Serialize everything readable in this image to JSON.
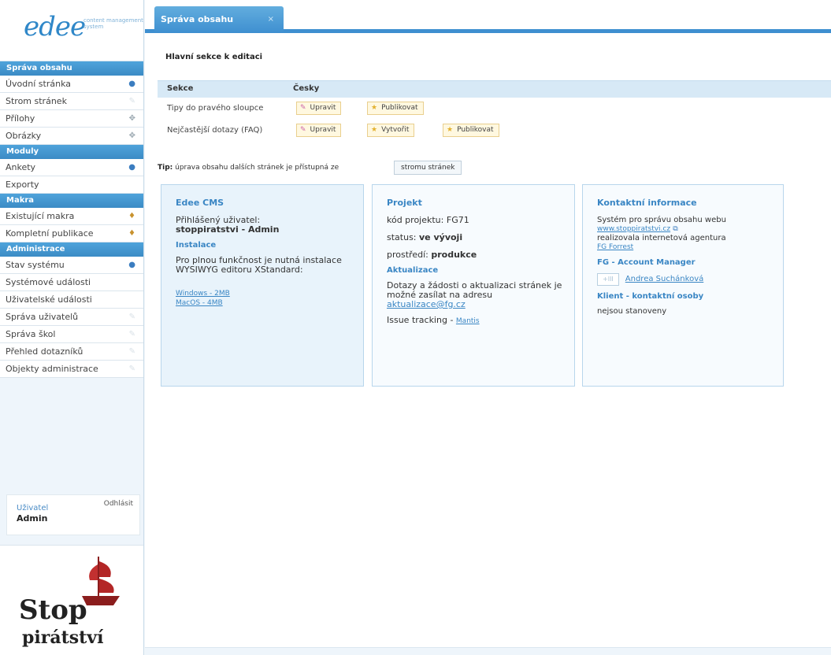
{
  "app": {
    "logo_text": "edee",
    "logo_sub": "content management system"
  },
  "sidebar": {
    "sections": [
      {
        "title": "Správa obsahu",
        "items": [
          {
            "label": "Úvodní stránka",
            "icon": "globe-icon"
          },
          {
            "label": "Strom stránek",
            "icon": "pencil-icon"
          },
          {
            "label": "Přílohy",
            "icon": "attachment-icon"
          },
          {
            "label": "Obrázky",
            "icon": "image-icon"
          }
        ]
      },
      {
        "title": "Moduly",
        "items": [
          {
            "label": "Ankety",
            "icon": "poll-icon"
          },
          {
            "label": "Exporty",
            "icon": ""
          }
        ]
      },
      {
        "title": "Makra",
        "items": [
          {
            "label": "Existující makra",
            "icon": "macro-icon"
          },
          {
            "label": "Kompletní publikace",
            "icon": "macro-icon"
          }
        ]
      },
      {
        "title": "Administrace",
        "items": [
          {
            "label": "Stav systému",
            "icon": "status-icon"
          },
          {
            "label": "Systémové události",
            "icon": ""
          },
          {
            "label": "Uživatelské události",
            "icon": ""
          },
          {
            "label": "Správa uživatelů",
            "icon": "pencil-icon"
          },
          {
            "label": "Správa škol",
            "icon": "pencil-icon"
          },
          {
            "label": "Přehled dotazníků",
            "icon": "pencil-icon"
          },
          {
            "label": "Objekty administrace",
            "icon": "pencil-icon"
          }
        ]
      }
    ],
    "user": {
      "label": "Uživatel",
      "name": "Admin",
      "logout": "Odhlásit"
    },
    "brand": {
      "line1": "Stop",
      "line2": "pirátství"
    }
  },
  "main": {
    "tab": {
      "label": "Správa obsahu",
      "close": "×"
    },
    "section_title": "Hlavní sekce k editaci",
    "table": {
      "headers": [
        "Sekce",
        "Česky"
      ],
      "rows": [
        {
          "label": "Tipy do pravého sloupce",
          "buttons": [
            "Upravit",
            "Publikovat"
          ]
        },
        {
          "label": "Nejčastější dotazy (FAQ)",
          "buttons": [
            "Upravit",
            "Vytvořit",
            "Publikovat"
          ]
        }
      ]
    },
    "tip": {
      "prefix": "Tip:",
      "text": "úprava obsahu dalších stránek je přístupná ze",
      "button": "stromu stránek"
    },
    "boxes": {
      "cms": {
        "title": "Edee CMS",
        "logged_label": "Přihlášený uživatel:",
        "logged_user": "stoppiratstvi - Admin",
        "install_title": "Instalace",
        "install_text": "Pro plnou funkčnost je nutná instalace WYSIWYG editoru XStandard:",
        "link_windows": "Windows - 2MB",
        "link_macos": "MacOS - 4MB"
      },
      "project": {
        "title": "Projekt",
        "code_label": "kód projektu:",
        "code": "FG71",
        "status_label": "status:",
        "status": "ve vývoji",
        "env_label": "prostředí:",
        "env": "produkce",
        "update_title": "Aktualizace",
        "update_text": "Dotazy a žádosti o aktualizaci stránek je možné zasílat na adresu",
        "update_email": "aktualizace@fg.cz",
        "issue_label": "Issue tracking -",
        "issue_link": "Mantis"
      },
      "contact": {
        "title": "Kontaktní informace",
        "text_before": "Systém pro správu obsahu webu",
        "site_link": "www.stoppiratstvi.cz",
        "text_after": "realizovala internetová agentura",
        "agency_link": "FG Forrest",
        "am_title": "FG - Account Manager",
        "am_badge": "+III",
        "am_name": "Andrea Suchánková",
        "client_title": "Klient - kontaktní osoby",
        "client_text": "nejsou stanoveny"
      }
    }
  },
  "colors": {
    "accent": "#3e8fd0",
    "section_head": "#3b8bc5",
    "button_bg": "#fff8e0"
  }
}
